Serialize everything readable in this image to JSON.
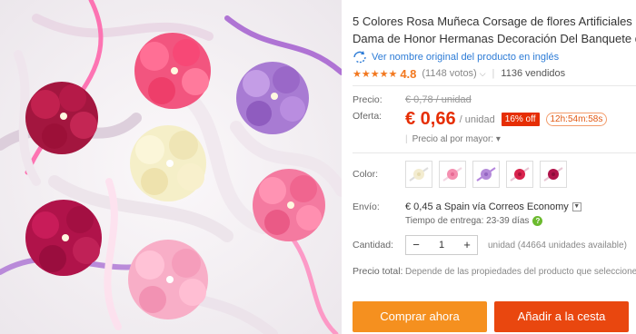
{
  "product": {
    "title_line1": "5 Colores Rosa Muñeca Corsage de flores Artificiales Flor",
    "title_line2": "Dama de Honor Hermanas Decoración Del Banquete de",
    "translate_link": "Ver nombre original del producto en inglés",
    "stars": "★★★★★",
    "rating": "4.8",
    "votes": "(1148 votos)",
    "sold": "1136 vendidos"
  },
  "price": {
    "label": "Precio:",
    "old": "€ 0,78 / unidad",
    "offer_label": "Oferta:",
    "current": "€ 0,66",
    "unit": "/ unidad",
    "discount": "16% off",
    "timer": "12h:54m:58s",
    "wholesale": "Precio al por mayor:"
  },
  "color": {
    "label": "Color:",
    "swatches": [
      "white-flower",
      "pink-flower",
      "purple-flower",
      "red-flower",
      "magenta-flower"
    ]
  },
  "shipping": {
    "label": "Envío:",
    "method": "€ 0,45 a Spain vía Correos Economy",
    "delivery_label": "Tiempo de entrega:",
    "delivery_value": "23-39 días"
  },
  "quantity": {
    "label": "Cantidad:",
    "value": "1",
    "available": "unidad (44664 unidades available)"
  },
  "total": {
    "label": "Precio total:",
    "value": "Depende de las propiedades del producto que seleccione"
  },
  "actions": {
    "buy_now": "Comprar ahora",
    "add_to_cart": "Añadir a la cesta"
  },
  "colors": {
    "accent_red": "#e62e04",
    "buy_orange": "#f5901f",
    "cart_red": "#e9470f",
    "rating_orange": "#f2781f",
    "link_blue": "#2c7bd6"
  }
}
